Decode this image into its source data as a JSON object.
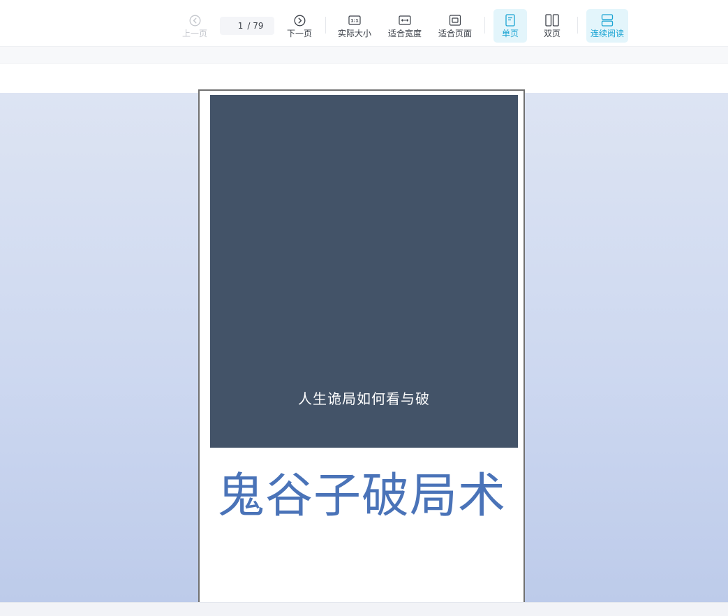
{
  "toolbar": {
    "prev_page": "上一页",
    "current_page": "1",
    "total_pages": "/ 79",
    "next_page": "下一页",
    "actual_size": "实际大小",
    "fit_width": "适合宽度",
    "fit_page": "适合页面",
    "single_page": "单页",
    "double_page": "双页",
    "continuous_reading": "连续阅读"
  },
  "document": {
    "cover_subtitle": "人生诡局如何看与破",
    "title": "鬼谷子破局术"
  },
  "colors": {
    "accent": "#1ba4d3",
    "cover": "#435368",
    "title": "#4a73b8"
  }
}
